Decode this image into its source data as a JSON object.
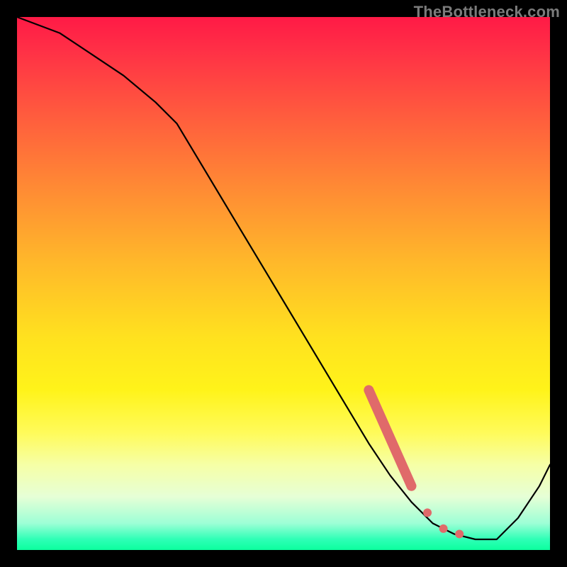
{
  "watermark": "TheBottleneck.com",
  "accent": {
    "dot_fill": "#e06a6a",
    "curve_stroke": "#000000"
  },
  "chart_data": {
    "type": "line",
    "title": "",
    "xlabel": "",
    "ylabel": "",
    "xlim": [
      0,
      100
    ],
    "ylim": [
      0,
      100
    ],
    "grid": false,
    "legend": false,
    "series": [
      {
        "name": "curve",
        "x": [
          0,
          8,
          14,
          20,
          26,
          30,
          36,
          42,
          48,
          54,
          60,
          66,
          70,
          74,
          78,
          82,
          86,
          90,
          94,
          98,
          100
        ],
        "y": [
          100,
          97,
          93,
          89,
          84,
          80,
          70,
          60,
          50,
          40,
          30,
          20,
          14,
          9,
          5,
          3,
          2,
          2,
          6,
          12,
          16
        ]
      }
    ],
    "markers": [
      {
        "name": "thick-segment",
        "kind": "segment",
        "x0": 66,
        "y0": 30,
        "x1": 74,
        "y1": 12,
        "width": 14
      },
      {
        "name": "dot-a",
        "kind": "dot",
        "x": 77,
        "y": 7,
        "r": 6
      },
      {
        "name": "dot-b",
        "kind": "dot",
        "x": 80,
        "y": 4,
        "r": 6
      },
      {
        "name": "dot-c",
        "kind": "dot",
        "x": 83,
        "y": 3,
        "r": 6
      }
    ]
  }
}
